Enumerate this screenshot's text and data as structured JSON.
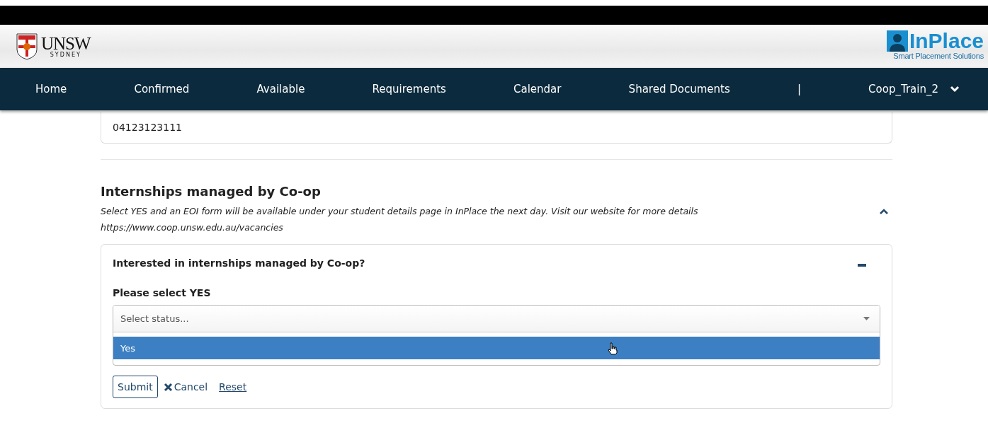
{
  "header": {
    "university_logo": {
      "name": "UNSW",
      "subtitle": "SYDNEY"
    },
    "product_logo": {
      "name": "InPlace",
      "tagline": "Smart Placement Solutions"
    }
  },
  "nav": {
    "items": [
      {
        "label": "Home"
      },
      {
        "label": "Confirmed"
      },
      {
        "label": "Available"
      },
      {
        "label": "Requirements"
      },
      {
        "label": "Calendar"
      },
      {
        "label": "Shared Documents"
      }
    ],
    "separator": "|",
    "user": "Coop_Train_2"
  },
  "contact_card": {
    "value": "04123123111"
  },
  "section": {
    "title": "Internships managed by Co-op",
    "expanded": true,
    "description": "Select YES and an EOI form will be available under your student details page in InPlace the next day. Visit our website for more details",
    "url": "https://www.coop.unsw.edu.au/vacancies",
    "question": {
      "title": "Interested in internships managed by Co-op?",
      "expanded": true,
      "field_label": "Please select YES",
      "placeholder": "Select status...",
      "dropdown_open": true,
      "options": [
        {
          "label": "Yes",
          "selected": true
        }
      ]
    },
    "actions": {
      "submit": "Submit",
      "cancel": "Cancel",
      "reset": "Reset"
    }
  }
}
